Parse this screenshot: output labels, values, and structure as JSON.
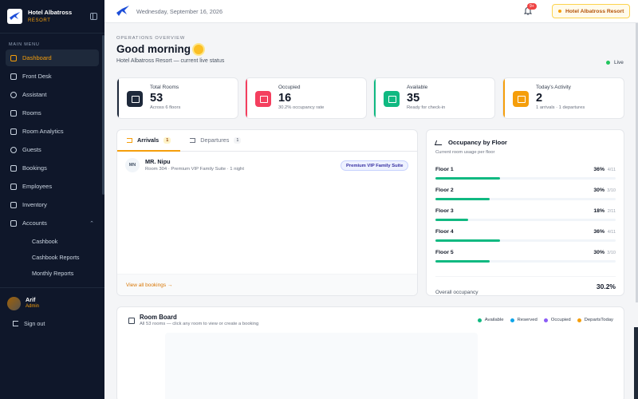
{
  "app": {
    "name": "Hotel Albatross",
    "tagline": "RESORT"
  },
  "sidebar": {
    "menu_label": "MAIN MENU",
    "items": [
      {
        "label": "Dashboard",
        "icon": "grid-icon",
        "active": true
      },
      {
        "label": "Front Desk",
        "icon": "clipboard-icon"
      },
      {
        "label": "Assistant",
        "icon": "chat-icon"
      },
      {
        "label": "Rooms",
        "icon": "bed-icon"
      },
      {
        "label": "Room Analytics",
        "icon": "chart-icon"
      },
      {
        "label": "Guests",
        "icon": "users-icon"
      },
      {
        "label": "Bookings",
        "icon": "calendar-icon"
      },
      {
        "label": "Employees",
        "icon": "id-card-icon"
      },
      {
        "label": "Inventory",
        "icon": "box-icon"
      },
      {
        "label": "Accounts",
        "icon": "wallet-icon",
        "expanded": true
      }
    ],
    "subitems": [
      {
        "label": "Cashbook"
      },
      {
        "label": "Cashbook Reports"
      },
      {
        "label": "Monthly Reports"
      }
    ],
    "user": {
      "name": "Arif",
      "role": "Admin"
    },
    "signout_label": "Sign out"
  },
  "topbar": {
    "date": "Wednesday, September 16, 2026",
    "notif_count": "9+",
    "resort_chip": "Hotel Albatross Resort"
  },
  "header": {
    "eyebrow": "OPERATIONS OVERVIEW",
    "greeting": "Good morning",
    "subtitle": "Hotel Albatross Resort — current live status",
    "live_label": "Live"
  },
  "stats": [
    {
      "label": "Total Rooms",
      "value": "53",
      "footer": "Across 6 floors",
      "color": "#1e293b"
    },
    {
      "label": "Occupied",
      "value": "16",
      "footer": "30.2% occupancy rate",
      "color": "#f43f5e"
    },
    {
      "label": "Available",
      "value": "35",
      "footer": "Ready for check-in",
      "color": "#10b981"
    },
    {
      "label": "Today's Activity",
      "value": "2",
      "footer": "1 arrivals · 1 departures",
      "color": "#f59e0b"
    }
  ],
  "arrivals": {
    "tabs": [
      {
        "label": "Arrivals",
        "count": "1",
        "active": true
      },
      {
        "label": "Departures",
        "count": "1"
      }
    ],
    "guests": [
      {
        "initials": "MN",
        "name": "MR. Nipu",
        "detail": "Room 304 · Premium VIP Family Suite · 1 night",
        "badge": "Premium VIP Family Suite"
      }
    ],
    "view_all": "View all bookings →"
  },
  "floors": {
    "title": "Occupancy by Floor",
    "subtitle": "Current room usage per floor",
    "items": [
      {
        "name": "Floor 1",
        "pct": "36%",
        "count": "4/11",
        "fill": 0.36
      },
      {
        "name": "Floor 2",
        "pct": "30%",
        "count": "3/10",
        "fill": 0.3
      },
      {
        "name": "Floor 3",
        "pct": "18%",
        "count": "2/11",
        "fill": 0.18
      },
      {
        "name": "Floor 4",
        "pct": "36%",
        "count": "4/11",
        "fill": 0.36
      },
      {
        "name": "Floor 5",
        "pct": "30%",
        "count": "3/10",
        "fill": 0.3
      }
    ],
    "overall_label": "Overall occupancy",
    "overall_value": "30.2%"
  },
  "room_board": {
    "title": "Room Board",
    "subtitle": "All 53 rooms — click any room to view or create a booking",
    "legend": [
      {
        "label": "Available",
        "color": "#10b981"
      },
      {
        "label": "Reserved",
        "color": "#0ea5e9"
      },
      {
        "label": "Occupied",
        "color": "#8b5cf6"
      },
      {
        "label": "DepartsToday",
        "color": "#f59e0b"
      }
    ]
  }
}
